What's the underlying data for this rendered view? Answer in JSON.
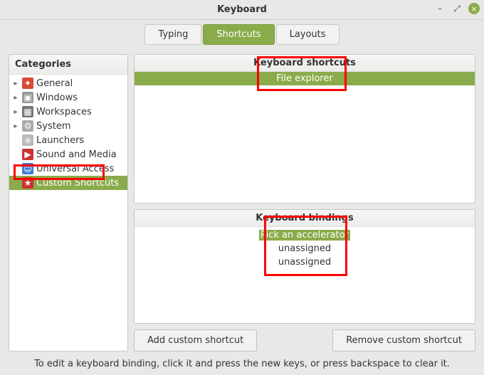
{
  "window": {
    "title": "Keyboard"
  },
  "tabs": {
    "typing": "Typing",
    "shortcuts": "Shortcuts",
    "layouts": "Layouts"
  },
  "sidebar": {
    "header": "Categories",
    "items": [
      {
        "label": "General"
      },
      {
        "label": "Windows"
      },
      {
        "label": "Workspaces"
      },
      {
        "label": "System"
      },
      {
        "label": "Launchers"
      },
      {
        "label": "Sound and Media"
      },
      {
        "label": "Universal Access"
      },
      {
        "label": "Custom Shortcuts"
      }
    ]
  },
  "shortcuts_panel": {
    "header": "Keyboard shortcuts",
    "selected": "File explorer"
  },
  "bindings_panel": {
    "header": "Keyboard bindings",
    "rows": [
      {
        "label": "Pick an accelerator"
      },
      {
        "label": "unassigned"
      },
      {
        "label": "unassigned"
      }
    ]
  },
  "buttons": {
    "add": "Add custom shortcut",
    "remove": "Remove custom shortcut"
  },
  "hint": "To edit a keyboard binding, click it and press the new keys, or press backspace to clear it."
}
